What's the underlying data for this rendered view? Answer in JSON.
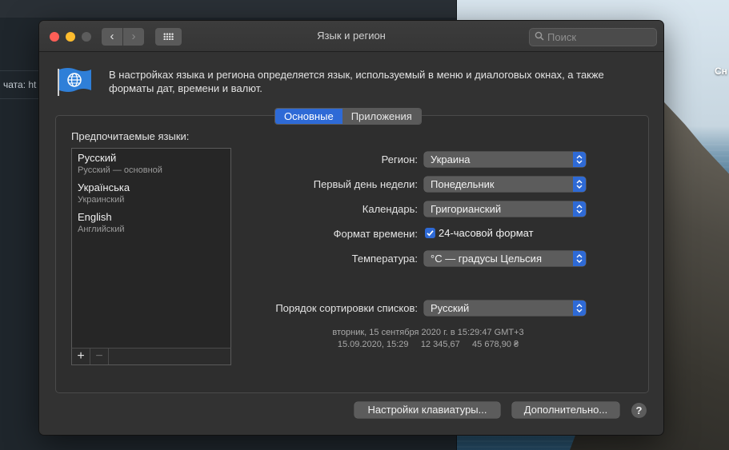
{
  "desktop": {
    "corner_label": "Сн"
  },
  "background_window": {
    "row_text": "чата: ht"
  },
  "window": {
    "title": "Язык и регион",
    "search_placeholder": "Поиск",
    "description": "В настройках языка и региона определяется язык, используемый в меню и диалоговых окнах, а также форматы дат, времени и валют.",
    "tabs": [
      {
        "label": "Основные",
        "active": true
      },
      {
        "label": "Приложения",
        "active": false
      }
    ]
  },
  "preferred_languages": {
    "label": "Предпочитаемые языки:",
    "items": [
      {
        "name": "Русский",
        "subtitle": "Русский — основной"
      },
      {
        "name": "Українська",
        "subtitle": "Украинский"
      },
      {
        "name": "English",
        "subtitle": "Английский"
      }
    ],
    "add_symbol": "+",
    "remove_symbol": "−"
  },
  "settings": {
    "region": {
      "label": "Регион:",
      "value": "Украина"
    },
    "first_day": {
      "label": "Первый день недели:",
      "value": "Понедельник"
    },
    "calendar": {
      "label": "Календарь:",
      "value": "Григорианский"
    },
    "time_format": {
      "label": "Формат времени:",
      "checkbox_label": "24-часовой формат",
      "checked": true
    },
    "temperature": {
      "label": "Температура:",
      "value": "°C — градусы Цельсия"
    },
    "sort_order": {
      "label": "Порядок сортировки списков:",
      "value": "Русский"
    }
  },
  "samples": {
    "line1": "вторник, 15 сентября 2020 г. в 15:29:47 GMT+3",
    "line2": "15.09.2020, 15:29     12 345,67     45 678,90 ₴"
  },
  "buttons": {
    "keyboard": "Настройки клавиатуры...",
    "advanced": "Дополнительно...",
    "help": "?"
  },
  "colors": {
    "accent": "#2e6ad6",
    "window_bg": "#323232",
    "close": "#ff5f57",
    "minimize": "#febc2e"
  }
}
